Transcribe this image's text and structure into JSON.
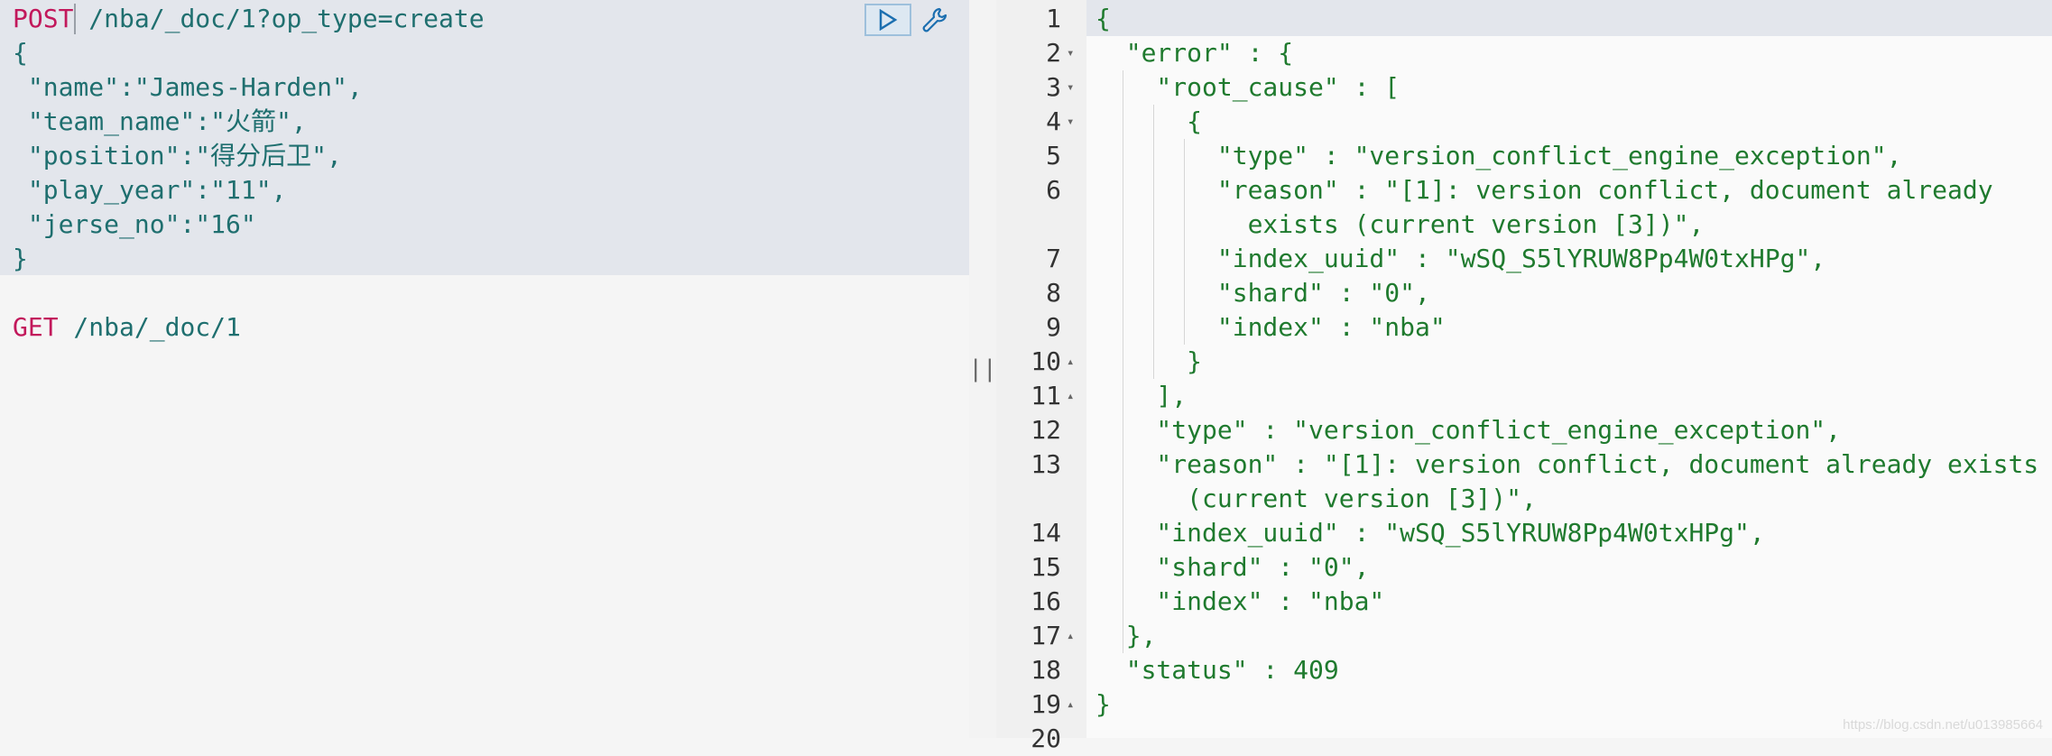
{
  "editor": {
    "requests": [
      {
        "method": "POST",
        "path": " /nba/_doc/1?op_type=create",
        "body_lines": [
          "{",
          " \"name\":\"James-Harden\",",
          " \"team_name\":\"火箭\",",
          " \"position\":\"得分后卫\",",
          " \"play_year\":\"11\",",
          " \"jerse_no\":\"16\"",
          "}"
        ]
      },
      {
        "method": "GET",
        "path": " /nba/_doc/1",
        "body_lines": []
      }
    ],
    "run_icon": "play-icon",
    "wrench_icon": "wrench-icon"
  },
  "splitter": {
    "grip": "||"
  },
  "response": {
    "line_numbers": [
      "1",
      "2",
      "3",
      "4",
      "5",
      "6",
      "",
      "7",
      "8",
      "9",
      "10",
      "11",
      "12",
      "13",
      "",
      "14",
      "15",
      "16",
      "17",
      "18",
      "19",
      "20"
    ],
    "lines": [
      "{",
      "  \"error\" : {",
      "    \"root_cause\" : [",
      "      {",
      "        \"type\" : \"version_conflict_engine_exception\",",
      "        \"reason\" : \"[1]: version conflict, document already",
      "          exists (current version [3])\",",
      "        \"index_uuid\" : \"wSQ_S5lYRUW8Pp4W0txHPg\",",
      "        \"shard\" : \"0\",",
      "        \"index\" : \"nba\"",
      "      }",
      "    ],",
      "    \"type\" : \"version_conflict_engine_exception\",",
      "    \"reason\" : \"[1]: version conflict, document already exists",
      "      (current version [3])\",",
      "    \"index_uuid\" : \"wSQ_S5lYRUW8Pp4W0txHPg\",",
      "    \"shard\" : \"0\",",
      "    \"index\" : \"nba\"",
      "  },",
      "  \"status\" : 409",
      "}"
    ]
  },
  "watermark": "https://blog.csdn.net/u013985664"
}
